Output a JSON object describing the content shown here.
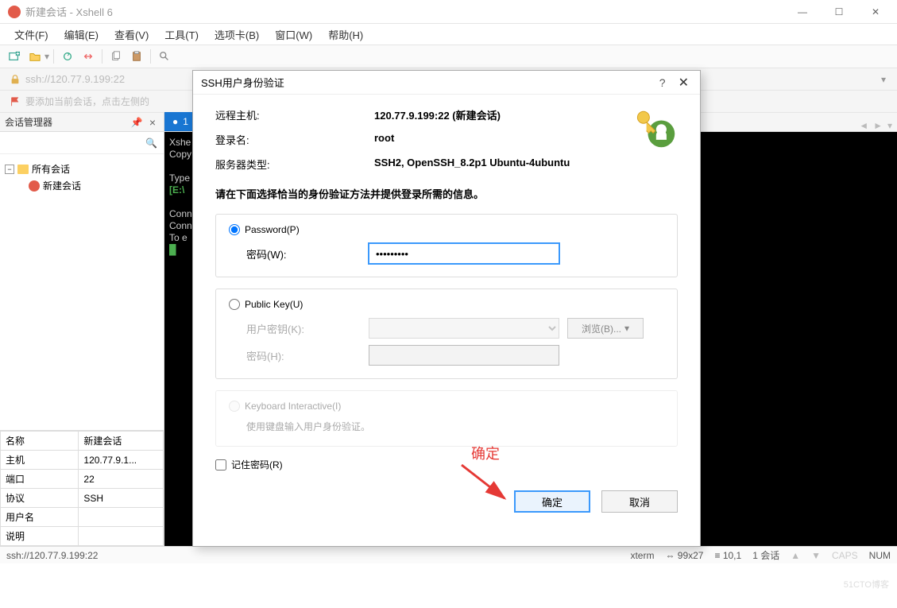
{
  "window": {
    "title": "新建会话 - Xshell 6",
    "minimize": "—",
    "maximize": "☐",
    "close": "✕"
  },
  "menu": {
    "file": "文件(F)",
    "edit": "编辑(E)",
    "view": "查看(V)",
    "tools": "工具(T)",
    "tab": "选项卡(B)",
    "window": "窗口(W)",
    "help": "帮助(H)"
  },
  "addressbar": {
    "text": "ssh://120.77.9.199:22"
  },
  "tipbar": {
    "text": "要添加当前会话，点击左侧的"
  },
  "session_manager": {
    "title": "会话管理器",
    "search_placeholder": "",
    "tree": {
      "root": "所有会话",
      "child1": "新建会话"
    },
    "props": {
      "name_k": "名称",
      "name_v": "新建会话",
      "host_k": "主机",
      "host_v": "120.77.9.1...",
      "port_k": "端口",
      "port_v": "22",
      "proto_k": "协议",
      "proto_v": "SSH",
      "user_k": "用户名",
      "user_v": "",
      "desc_k": "说明",
      "desc_v": ""
    }
  },
  "tabs": {
    "tab1": "1",
    "add": "+"
  },
  "terminal": {
    "line1": "Xshe",
    "line2": "Copy",
    "line3": "Type",
    "line4": "[E:\\",
    "line5": "Conn",
    "line6": "Conn",
    "line7": "To e"
  },
  "dialog": {
    "title": "SSH用户身份验证",
    "help": "?",
    "close": "✕",
    "remote_host_k": "远程主机:",
    "remote_host_v": "120.77.9.199:22 (新建会话)",
    "login_k": "登录名:",
    "login_v": "root",
    "server_type_k": "服务器类型:",
    "server_type_v": "SSH2, OpenSSH_8.2p1 Ubuntu-4ubuntu",
    "instruction": "请在下面选择恰当的身份验证方法并提供登录所需的信息。",
    "password_radio": "Password(P)",
    "password_label": "密码(W):",
    "password_value": "•••••••••",
    "publickey_radio": "Public Key(U)",
    "userkey_label": "用户密钥(K):",
    "browse": "浏览(B)...",
    "pk_pass_label": "密码(H):",
    "ki_radio": "Keyboard Interactive(I)",
    "ki_desc": "使用键盘输入用户身份验证。",
    "remember": "记住密码(R)",
    "ok": "确定",
    "cancel": "取消",
    "annotation": "确定"
  },
  "statusbar": {
    "left": "ssh://120.77.9.199:22",
    "term": "xterm",
    "size": "99x27",
    "pos": "10,1",
    "sessions": "1 会话",
    "caps": "CAPS",
    "num": "NUM"
  },
  "watermark": "51CTO博客"
}
